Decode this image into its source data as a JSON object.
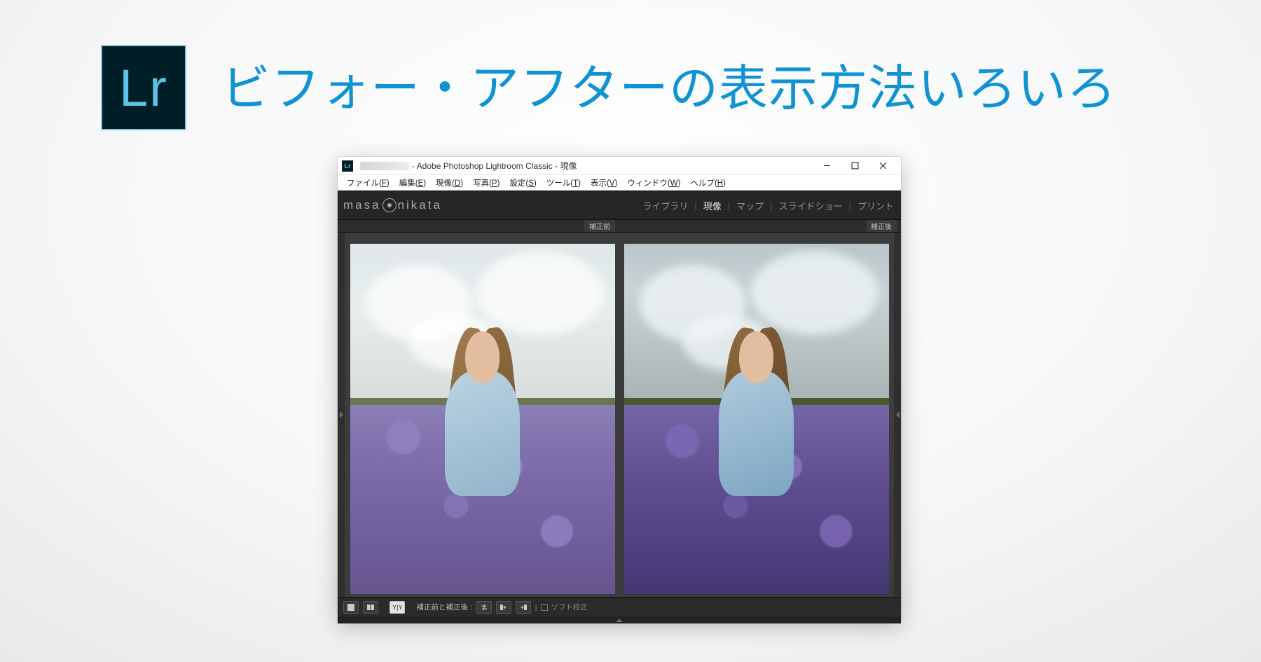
{
  "page": {
    "headline": "ビフォー・アフターの表示方法いろいろ",
    "icon_text": "Lr"
  },
  "window": {
    "app_glyph": "Lr",
    "title_suffix": " - Adobe Photoshop Lightroom Classic - 現像"
  },
  "menubar": [
    {
      "label": "ファイル",
      "mnemonic": "F"
    },
    {
      "label": "編集",
      "mnemonic": "E"
    },
    {
      "label": "現像",
      "mnemonic": "D"
    },
    {
      "label": "写真",
      "mnemonic": "P"
    },
    {
      "label": "設定",
      "mnemonic": "S"
    },
    {
      "label": "ツール",
      "mnemonic": "T"
    },
    {
      "label": "表示",
      "mnemonic": "V"
    },
    {
      "label": "ウィンドウ",
      "mnemonic": "W"
    },
    {
      "label": "ヘルプ",
      "mnemonic": "H"
    }
  ],
  "brand": {
    "left": "masa",
    "right": "nikata"
  },
  "modules": {
    "items": [
      "ライブラリ",
      "現像",
      "マップ",
      "スライドショー",
      "プリント"
    ],
    "active": "現像",
    "separator": "|"
  },
  "compare": {
    "before_label": "補正前",
    "after_label": "補正後"
  },
  "toolbar": {
    "loupe_tooltip": "ルーペ表示",
    "compare_side_tooltip": "左右比較",
    "compare_yy_label": "Y|Y",
    "mode_label": "補正前と補正後 :",
    "swap_tooltip": "入れ替え",
    "copy_left_tooltip": "左へコピー",
    "copy_right_tooltip": "右へコピー",
    "soft_proof_label": "ソフト校正"
  }
}
